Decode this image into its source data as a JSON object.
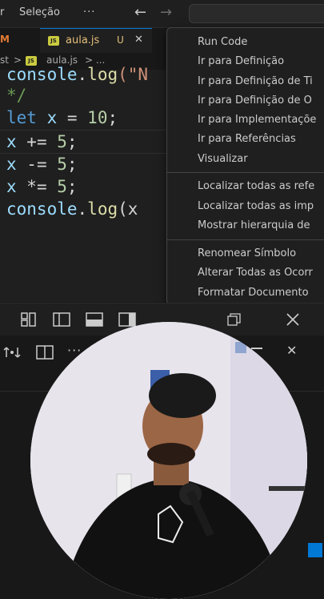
{
  "menubar": {
    "partial_left": "r",
    "selection": "Seleção",
    "more": "···"
  },
  "tabs": {
    "partial_left_tab": "M",
    "active_tab_icon": "JS",
    "active_tab_label": "aula.js",
    "active_tab_status": "U",
    "close": "✕"
  },
  "breadcrumb": {
    "part1": "st",
    "sep": ">",
    "file_icon": "JS",
    "file": "aula.js",
    "ellipsis": "> ..."
  },
  "editor": {
    "lines": [
      {
        "t1": "console",
        "t2": ".",
        "t3": "log",
        "t4": "(\"N"
      },
      {
        "t1": "*/"
      },
      {
        "t1": "let",
        "t2": " x",
        "t3": " =",
        "t4": " 10",
        "t5": ";"
      },
      {
        "t1": "x",
        "t2": " +=",
        "t3": " 5",
        "t4": ";"
      },
      {
        "t1": "x",
        "t2": " -=",
        "t3": " 5",
        "t4": ";"
      },
      {
        "t1": "x",
        "t2": " *=",
        "t3": " 5",
        "t4": ";"
      },
      {
        "t1": "console",
        "t2": ".",
        "t3": "log",
        "t4": "(x"
      }
    ]
  },
  "context_menu": {
    "items": [
      "Run Code",
      "Ir para Definição",
      "Ir para Definição de Ti",
      "Ir para Definição de O",
      "Ir para Implementaçõe",
      "Ir para Referências",
      "Visualizar",
      "Localizar todas as refe",
      "Localizar todas as imp",
      "Mostrar hierarquia de",
      "Renomear Símbolo",
      "Alterar Todas as Ocorr",
      "Formatar Documento"
    ]
  },
  "panel": {
    "more": "···",
    "close": "✕"
  },
  "colors": {
    "accent": "#0078d4",
    "editor_bg": "#1f1f1f",
    "keyword": "#569cd6",
    "number": "#b5cea8"
  }
}
